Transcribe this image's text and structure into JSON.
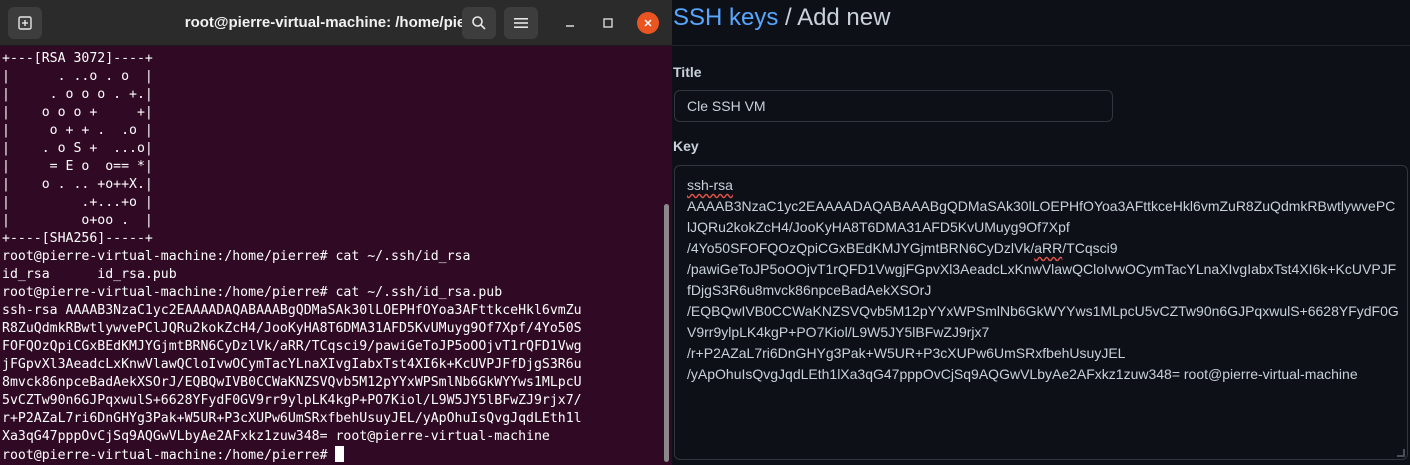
{
  "terminal": {
    "title": "root@pierre-virtual-machine: /home/pierre",
    "icons": {
      "new_tab": "new-tab-icon",
      "search": "search-icon",
      "menu": "hamburger-menu-icon",
      "minimize": "minimize-icon",
      "maximize": "maximize-icon",
      "close": "close-icon"
    },
    "lines": [
      "+---[RSA 3072]----+",
      "|      . ..o . o  |",
      "|     . o o o . +.|",
      "|    o o o +     +|",
      "|     o + + .  .o |",
      "|    . o S +  ...o|",
      "|     = E o  o== *|",
      "|    o . .. +o++X.|",
      "|         .+...+o |",
      "|         o+oo .  |",
      "+----[SHA256]-----+",
      "root@pierre-virtual-machine:/home/pierre# cat ~/.ssh/id_rsa",
      "id_rsa      id_rsa.pub",
      "root@pierre-virtual-machine:/home/pierre# cat ~/.ssh/id_rsa.pub",
      "ssh-rsa AAAAB3NzaC1yc2EAAAADAQABAAABgQDMaSAk30lLOEPHfOYoa3AFttkceHkl6vmZu",
      "R8ZuQdmkRBwtlywvePClJQRu2kokZcH4/JooKyHA8T6DMA31AFD5KvUMuyg9Of7Xpf/4Yo50S",
      "FOFQOzQpiCGxBEdKMJYGjmtBRN6CyDzlVk/aRR/TCqsci9/pawiGeToJP5oOOjvT1rQFD1Vwg",
      "jFGpvXl3AeadcLxKnwVlawQCloIvwOCymTacYLnaXIvgIabxTst4XI6k+KcUVPJFfDjgS3R6u",
      "8mvck86npceBadAekXSOrJ/EQBQwIVB0CCWaKNZSVQvb5M12pYYxWPSmlNb6GkWYYws1MLpcU",
      "5vCZTw90n6GJPqxwulS+6628YFydF0GV9rr9ylpLK4kgP+PO7Kiol/L9W5JY5lBFwZJ9rjx7/",
      "r+P2AZaL7ri6DnGHYg3Pak+W5UR+P3cXUPw6UmSRxfbehUsuyJEL/yApOhuIsQvgJqdLEth1l",
      "Xa3qG47pppOvCjSq9AQGwVLbyAe2AFxkz1zuw348= root@pierre-virtual-machine"
    ],
    "prompt": "root@pierre-virtual-machine:/home/pierre# "
  },
  "github": {
    "breadcrumb": {
      "link": "SSH keys",
      "separator": " / ",
      "current": "Add new"
    },
    "title_label": "Title",
    "title_value": "Cle SSH VM",
    "key_label": "Key",
    "key_lines": {
      "l0": "ssh-rsa",
      "l1": "AAAAB3NzaC1yc2EAAAADAQABAAABgQDMaSAk30lLOEPHfOYoa3AFttkceHkl6vmZuR8ZuQdmkRBwtlywvePC",
      "l2": "lJQRu2kokZcH4/JooKyHA8T6DMA31AFD5KvUMuyg9Of7Xpf",
      "l3a": "/4Yo50SFOFQOzQpiCGxBEdKMJYGjmtBRN6CyDzlVk/",
      "l3b": "aRR",
      "l3c": "/TCqsci9",
      "l4": "/pawiGeToJP5oOOjvT1rQFD1VwgjFGpvXl3AeadcLxKnwVlawQCloIvwOCymTacYLnaXIvgIabxTst4XI6k+KcUVPJF",
      "l5": "fDjgS3R6u8mvck86npceBadAekXSOrJ",
      "l6": "/EQBQwIVB0CCWaKNZSVQvb5M12pYYxWPSmlNb6GkWYYws1MLpcU5vCZTw90n6GJPqxwulS+6628YFydF0G",
      "l7": "V9rr9ylpLK4kgP+PO7Kiol/L9W5JY5lBFwZJ9rjx7",
      "l8": "/r+P2AZaL7ri6DnGHYg3Pak+W5UR+P3cXUPw6UmSRxfbehUsuyJEL",
      "l9": "/yApOhuIsQvgJqdLEth1lXa3qG47pppOvCjSq9AQGwVLbyAe2AFxkz1zuw348= root@pierre-virtual-machine"
    },
    "colors": {
      "link": "#58a6ff",
      "text": "#c9d1d9",
      "border": "#30363d",
      "bg": "#0d1117"
    }
  }
}
